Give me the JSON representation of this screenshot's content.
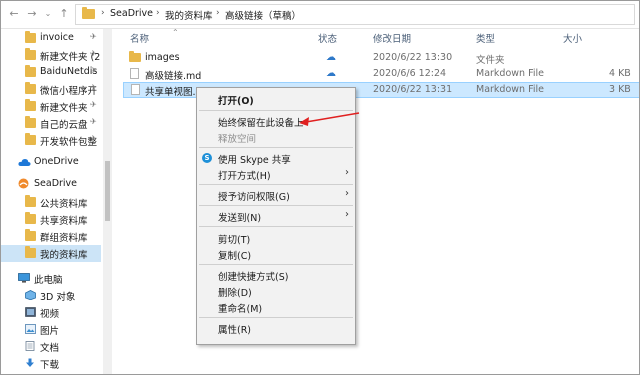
{
  "address": {
    "crumbs": [
      "SeaDrive",
      "我的资料库",
      "高级链接（草稿）"
    ]
  },
  "sidebar": {
    "items": [
      {
        "label": "invoice",
        "pinned": true,
        "type": "folder"
      },
      {
        "label": "新建文件夹 (2",
        "pinned": true,
        "type": "folder"
      },
      {
        "label": "BaiduNetdis",
        "pinned": true,
        "type": "folder"
      },
      {
        "label": "微信小程序开",
        "pinned": true,
        "type": "folder"
      },
      {
        "label": "新建文件夹",
        "pinned": true,
        "type": "folder"
      },
      {
        "label": "自己的云盘",
        "pinned": true,
        "type": "folder"
      },
      {
        "label": "开发软件包整",
        "pinned": true,
        "type": "folder"
      },
      {
        "label": "OneDrive",
        "type": "onedrive"
      },
      {
        "label": "SeaDrive",
        "type": "seadrive"
      },
      {
        "label": "公共资料库",
        "type": "folder"
      },
      {
        "label": "共享资料库",
        "type": "folder"
      },
      {
        "label": "群组资料库",
        "type": "folder"
      },
      {
        "label": "我的资料库",
        "type": "folder",
        "selected": true
      },
      {
        "label": "此电脑",
        "type": "pc"
      },
      {
        "label": "3D 对象",
        "type": "3d"
      },
      {
        "label": "视频",
        "type": "video"
      },
      {
        "label": "图片",
        "type": "pictures"
      },
      {
        "label": "文档",
        "type": "docs"
      },
      {
        "label": "下载",
        "type": "download"
      }
    ],
    "pin_glyph": "✈"
  },
  "columns": {
    "name": "名称",
    "status": "状态",
    "modified": "修改日期",
    "type": "类型",
    "size": "大小"
  },
  "files": [
    {
      "name": "images",
      "modified": "2020/6/22 13:30",
      "type": "文件夹",
      "size": "",
      "icon": "folder-icon"
    },
    {
      "name": "高级链接.md",
      "modified": "2020/6/6 12:24",
      "type": "Markdown File",
      "size": "4 KB",
      "icon": "file-icon"
    },
    {
      "name": "共享单视图.md",
      "modified": "2020/6/22 13:31",
      "type": "Markdown File",
      "size": "3 KB",
      "icon": "file-icon",
      "selected": true
    }
  ],
  "context_menu": {
    "open": "打开(O)",
    "keep_on_device": "始终保留在此设备上",
    "free_space": "释放空间",
    "skype_share": "使用 Skype 共享",
    "open_with": "打开方式(H)",
    "grant_access": "授予访问权限(G)",
    "send_to": "发送到(N)",
    "cut": "剪切(T)",
    "copy": "复制(C)",
    "create_shortcut": "创建快捷方式(S)",
    "delete": "删除(D)",
    "rename": "重命名(M)",
    "properties": "属性(R)",
    "submenu_arrow": "›"
  },
  "colors": {
    "selection": "#cce8ff",
    "sidebar_selection": "#cce4f7",
    "cloud_icon": "#2f79c9",
    "annotation_arrow": "#e02020"
  }
}
